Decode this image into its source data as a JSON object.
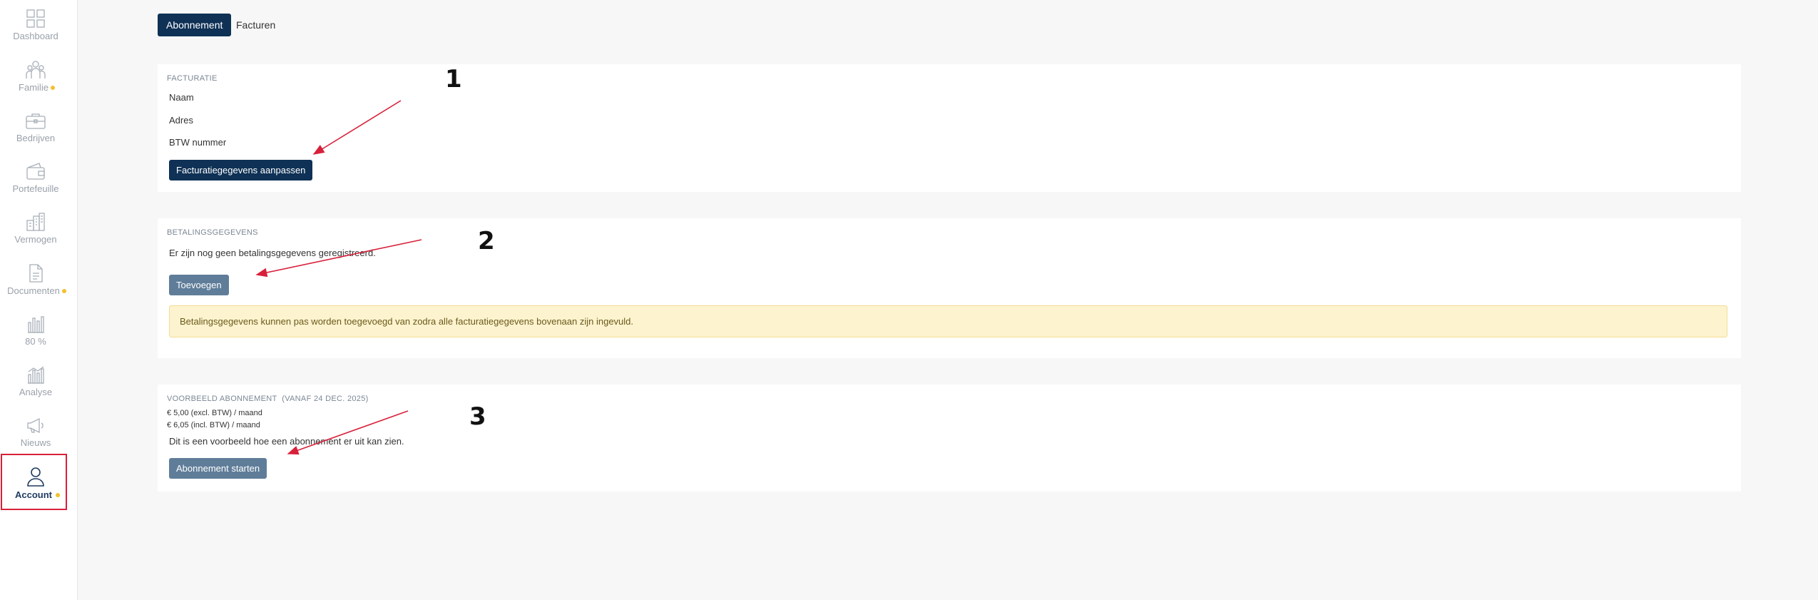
{
  "sidebar": {
    "items": [
      {
        "label": "Dashboard",
        "icon": "dashboard-icon",
        "dot": false
      },
      {
        "label": "Familie",
        "icon": "family-icon",
        "dot": true
      },
      {
        "label": "Bedrijven",
        "icon": "briefcase-icon",
        "dot": false
      },
      {
        "label": "Portefeuille",
        "icon": "wallet-icon",
        "dot": false
      },
      {
        "label": "Vermogen",
        "icon": "buildings-icon",
        "dot": false
      },
      {
        "label": "Documenten",
        "icon": "document-icon",
        "dot": true
      },
      {
        "label": "80 %",
        "icon": "bar-chart-icon",
        "dot": false
      },
      {
        "label": "Analyse",
        "icon": "analysis-chart-icon",
        "dot": false
      },
      {
        "label": "Nieuws",
        "icon": "megaphone-icon",
        "dot": false
      },
      {
        "label": "Account",
        "icon": "user-icon",
        "dot": true,
        "active": true
      }
    ]
  },
  "tabs": {
    "subscription": "Abonnement",
    "invoices": "Facturen"
  },
  "billing": {
    "title": "FACTURATIE",
    "name_label": "Naam",
    "address_label": "Adres",
    "vat_label": "BTW nummer",
    "edit_button": "Facturatiegegevens aanpassen"
  },
  "payment": {
    "title": "BETALINGSGEGEVENS",
    "empty_text": "Er zijn nog geen betalingsgegevens geregistreerd.",
    "add_button": "Toevoegen",
    "warning": "Betalingsgegevens kunnen pas worden toegevoegd van zodra alle facturatiegegevens bovenaan zijn ingevuld."
  },
  "subscription": {
    "title": "VOORBEELD ABONNEMENT",
    "since": "(VANAF 24 DEC. 2025)",
    "price_excl": "€ 5,00 (excl. BTW) / maand",
    "price_incl": "€ 6,05 (incl. BTW) / maand",
    "description": "Dit is een voorbeeld hoe een abonnement er uit kan zien.",
    "start_button": "Abonnement starten"
  },
  "annotations": {
    "step1": "1",
    "step2": "2",
    "step3": "3",
    "arrow_color": "#d8203a"
  },
  "colors": {
    "primary": "#0e3155",
    "secondary": "#5f7d99",
    "dot": "#f2c12e"
  }
}
